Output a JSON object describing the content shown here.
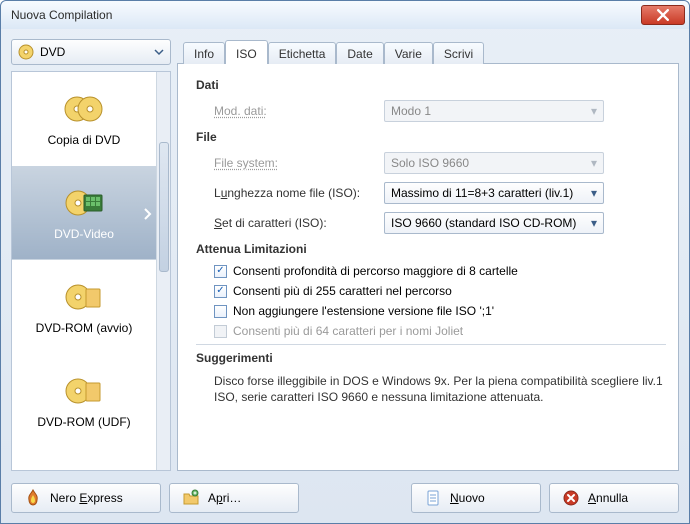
{
  "window": {
    "title": "Nuova Compilation"
  },
  "disc_selector": {
    "label": "DVD"
  },
  "sidebar": {
    "items": [
      {
        "label": "Copia di DVD"
      },
      {
        "label": "DVD-Video"
      },
      {
        "label": "DVD-ROM (avvio)"
      },
      {
        "label": "DVD-ROM (UDF)"
      }
    ],
    "selected_index": 1
  },
  "tabs": {
    "items": [
      {
        "label": "Info"
      },
      {
        "label": "ISO"
      },
      {
        "label": "Etichetta"
      },
      {
        "label": "Date"
      },
      {
        "label": "Varie"
      },
      {
        "label": "Scrivi"
      }
    ],
    "active_index": 1
  },
  "iso": {
    "section_data": "Dati",
    "mod_data_label": "Mod. dati:",
    "mod_data_value": "Modo 1",
    "section_file": "File",
    "filesystem_label": "File system:",
    "filesystem_value": "Solo ISO 9660",
    "filename_len_label_pre": "L",
    "filename_len_label_ul": "u",
    "filename_len_label_post": "nghezza nome file (ISO):",
    "filename_len_value": "Massimo di 11=8+3 caratteri (liv.1)",
    "charset_label_pre": "",
    "charset_label_ul": "S",
    "charset_label_post": "et di caratteri (ISO):",
    "charset_value": "ISO 9660 (standard ISO CD-ROM)",
    "section_limits": "Attenua Limitazioni",
    "chk1": "Consenti profondità di percorso maggiore di 8 cartelle",
    "chk2": "Consenti più di 255 caratteri nel percorso",
    "chk3": "Non aggiungere l'estensione versione file ISO ';1'",
    "chk4": "Consenti più di 64 caratteri per i nomi Joliet",
    "section_hints": "Suggerimenti",
    "hint": "Disco forse illeggibile in DOS e Windows 9x. Per la piena compatibilità scegliere liv.1 ISO, serie caratteri ISO 9660 e nessuna limitazione attenuata."
  },
  "buttons": {
    "nero_express": "Nero Express",
    "nero_express_ul": "E",
    "nero_express_pre": "Nero ",
    "nero_express_post": "xpress",
    "open_pre": "A",
    "open_ul": "p",
    "open_post": "ri…",
    "new_pre": "",
    "new_ul": "N",
    "new_post": "uovo",
    "cancel_pre": "",
    "cancel_ul": "A",
    "cancel_post": "nnulla"
  }
}
